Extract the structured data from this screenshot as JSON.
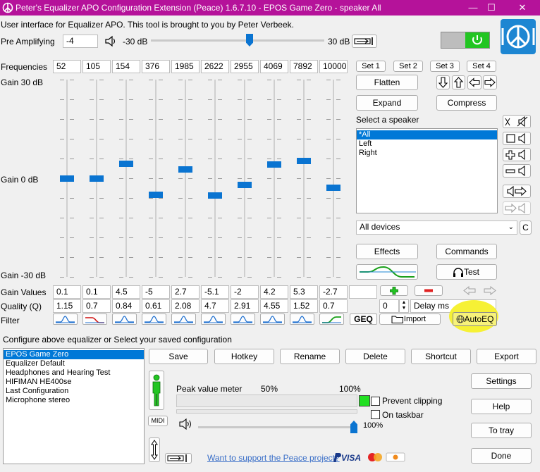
{
  "window": {
    "title": "Peter's Equalizer APO Configuration Extension (Peace) 1.6.7.10 - EPOS Game Zero - speaker All",
    "minimize": "—",
    "maximize": "☐",
    "close": "✕"
  },
  "intro_text": "User interface for Equalizer APO. This tool is brought to you by Peter Verbeek.",
  "pre_amp": {
    "label": "Pre Amplifying",
    "value": "-4",
    "min_label": "-30 dB",
    "max_label": "30 dB",
    "level": 0.57
  },
  "power": {
    "state": "on",
    "color": "#22c522"
  },
  "labels": {
    "frequencies": "Frequencies",
    "gain_top": "Gain 30 dB",
    "gain_mid": "Gain 0 dB",
    "gain_bottom": "Gain -30 dB",
    "gain_values": "Gain Values",
    "quality": "Quality (Q)",
    "filter": "Filter"
  },
  "bands": [
    {
      "freq": "52",
      "gain": "0.1",
      "q": "1.15",
      "gain_db": 0.1
    },
    {
      "freq": "105",
      "gain": "0.1",
      "q": "0.7",
      "gain_db": 0.1
    },
    {
      "freq": "154",
      "gain": "4.5",
      "q": "0.84",
      "gain_db": 4.5
    },
    {
      "freq": "376",
      "gain": "-5",
      "q": "0.61",
      "gain_db": -5
    },
    {
      "freq": "1985",
      "gain": "2.7",
      "q": "2.08",
      "gain_db": 2.7
    },
    {
      "freq": "2622",
      "gain": "-5.1",
      "q": "4.7",
      "gain_db": -5.1
    },
    {
      "freq": "2955",
      "gain": "-2",
      "q": "2.91",
      "gain_db": -2
    },
    {
      "freq": "4069",
      "gain": "4.2",
      "q": "4.55",
      "gain_db": 4.2
    },
    {
      "freq": "7892",
      "gain": "5.3",
      "q": "1.52",
      "gain_db": 5.3
    },
    {
      "freq": "10000",
      "gain": "-2.7",
      "q": "0.7",
      "gain_db": -2.7
    }
  ],
  "sets": [
    "Set 1",
    "Set 2",
    "Set 3",
    "Set 4"
  ],
  "buttons": {
    "flatten": "Flatten",
    "expand": "Expand",
    "compress": "Compress",
    "effects": "Effects",
    "commands": "Commands",
    "test": "Test",
    "geq": "GEQ",
    "import": "Import",
    "autoeq": "AutoEQ",
    "c": "C",
    "delay_value": "0",
    "delay_unit": "Delay ms"
  },
  "speaker": {
    "label": "Select a speaker",
    "items": [
      "*All",
      "Left",
      "Right"
    ],
    "selected": 0
  },
  "device": {
    "value": "All devices"
  },
  "config": {
    "label": "Configure above equalizer or Select your saved configuration",
    "items": [
      "EPOS Game Zero",
      "Equalizer Default",
      "Headphones and Hearing Test",
      "HIFIMAN HE400se",
      "Last Configuration",
      "Microphone stereo"
    ],
    "selected": 0,
    "save": "Save",
    "hotkey": "Hotkey",
    "rename": "Rename",
    "delete": "Delete",
    "shortcut": "Shortcut",
    "export": "Export"
  },
  "meter": {
    "label": "Peak value meter",
    "mark_50": "50%",
    "mark_100": "100%",
    "midi": "MIDI",
    "volume_label": "100%",
    "volume_level": 1.0,
    "prevent_clipping": "Prevent clipping",
    "on_taskbar": "On taskbar"
  },
  "side": {
    "settings": "Settings",
    "help": "Help",
    "to_tray": "To tray",
    "done": "Done"
  },
  "support_link": "Want to support the Peace project?",
  "payment": "PayPal VISA MasterCard DISCOVER",
  "colors": {
    "title_bar": "#b5129a",
    "accent": "#0a74d1",
    "highlight": "#f5f02a",
    "power": "#22c522"
  }
}
